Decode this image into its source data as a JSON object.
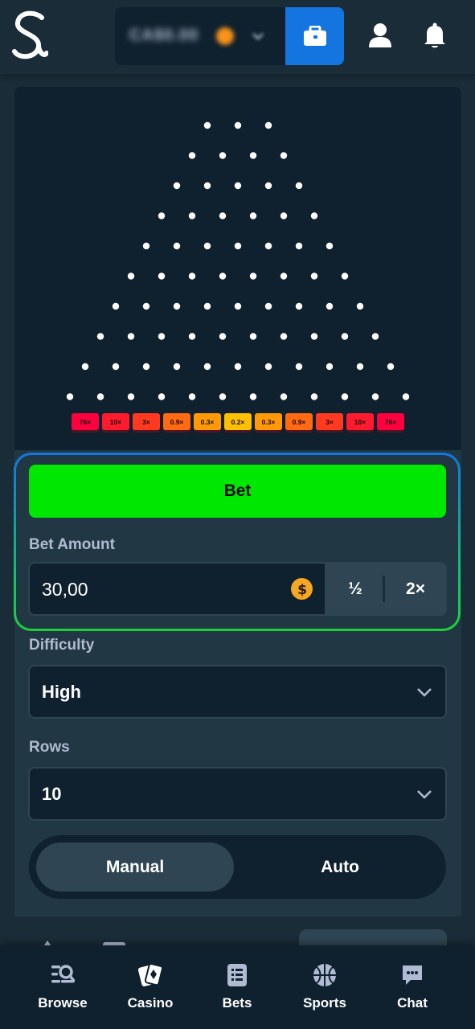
{
  "header": {
    "logo_text": "S",
    "balance_masked": "CA$0.00",
    "icons": [
      "wallet-icon",
      "user-icon",
      "bell-icon"
    ]
  },
  "board": {
    "multipliers": [
      "76×",
      "10×",
      "3×",
      "0.9×",
      "0.3×",
      "0.2×",
      "0.3×",
      "0.9×",
      "3×",
      "10×",
      "76×"
    ],
    "multiplier_colors": [
      "#ff003f",
      "#ff1b2f",
      "#ff3a21",
      "#ff6a12",
      "#ff9a06",
      "#ffc000",
      "#ff9a06",
      "#ff6a12",
      "#ff3a21",
      "#ff1b2f",
      "#ff003f"
    ]
  },
  "controls": {
    "bet_label": "Bet",
    "bet_amount_label": "Bet Amount",
    "bet_amount_value": "30,00",
    "half_label": "½",
    "double_label": "2×",
    "difficulty_label": "Difficulty",
    "difficulty_value": "High",
    "rows_label": "Rows",
    "rows_value": "10",
    "mode_manual": "Manual",
    "mode_auto": "Auto",
    "selected_mode": "Manual"
  },
  "bottom_nav": {
    "items": [
      {
        "label": "Browse",
        "icon": "browse-icon"
      },
      {
        "label": "Casino",
        "icon": "casino-icon"
      },
      {
        "label": "Bets",
        "icon": "bets-icon"
      },
      {
        "label": "Sports",
        "icon": "sports-icon"
      },
      {
        "label": "Chat",
        "icon": "chat-icon"
      }
    ]
  },
  "colors": {
    "bg": "#1a2c38",
    "panel": "#213743",
    "dark": "#0f212e",
    "accent_green": "#00e701",
    "accent_blue": "#1475e1"
  }
}
